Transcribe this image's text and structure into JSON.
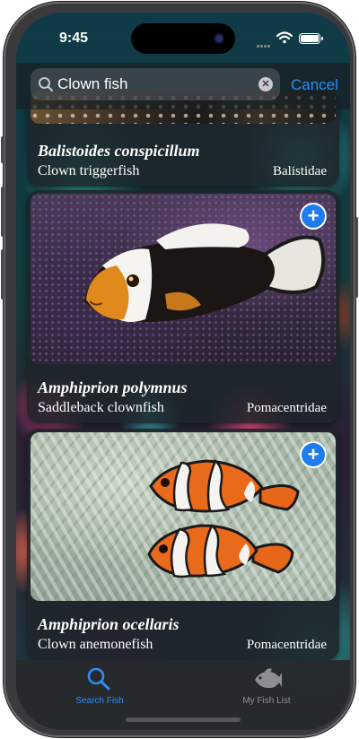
{
  "status_bar": {
    "time": "9:45"
  },
  "search": {
    "value": "Clown fish",
    "cancel_label": "Cancel"
  },
  "results": [
    {
      "scientific_name": "Balistoides conspicillum",
      "common_name": "Clown triggerfish",
      "family": "Balistidae",
      "add_icon": "plus-circle"
    },
    {
      "scientific_name": "Amphiprion polymnus",
      "common_name": "Saddleback clownfish",
      "family": "Pomacentridae",
      "add_icon": "plus-circle"
    },
    {
      "scientific_name": "Amphiprion ocellaris",
      "common_name": "Clown anemonefish",
      "family": "Pomacentridae",
      "add_icon": "plus-circle"
    }
  ],
  "tab_bar": {
    "tabs": [
      {
        "label": "Search Fish",
        "icon": "magnifyingglass-icon",
        "selected": true
      },
      {
        "label": "My Fish List",
        "icon": "fish-icon",
        "selected": false
      }
    ]
  },
  "colors": {
    "accent": "#2f8cf6",
    "add_button": "#1e7cf0",
    "inactive_tab": "#8e8e93"
  }
}
